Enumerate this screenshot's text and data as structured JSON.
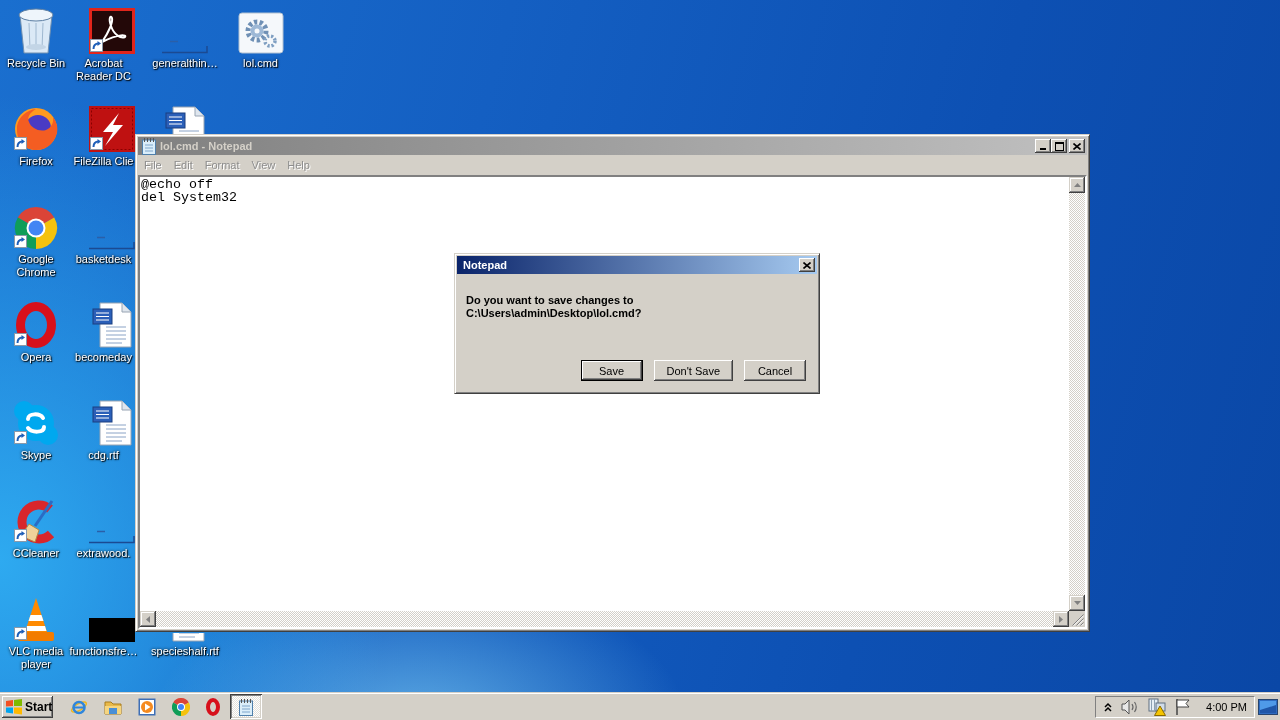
{
  "desktop": {
    "icons": [
      {
        "label": "Recycle Bin",
        "kind": "recycle-bin",
        "shortcut": false
      },
      {
        "label": "Firefox",
        "kind": "firefox",
        "shortcut": true
      },
      {
        "label": "Google Chrome",
        "kind": "chrome",
        "shortcut": true
      },
      {
        "label": "Opera",
        "kind": "opera",
        "shortcut": true
      },
      {
        "label": "Skype",
        "kind": "skype",
        "shortcut": true
      },
      {
        "label": "CCleaner",
        "kind": "ccleaner",
        "shortcut": true
      },
      {
        "label": "VLC media player",
        "kind": "vlc",
        "shortcut": true
      },
      {
        "label": "Acrobat Reader DC",
        "kind": "acrobat",
        "shortcut": true
      },
      {
        "label": "FileZilla Clie",
        "kind": "filezilla",
        "shortcut": true
      },
      {
        "label": "basketdesk",
        "kind": "line-file",
        "shortcut": false
      },
      {
        "label": "becomeday",
        "kind": "document",
        "shortcut": false
      },
      {
        "label": "cdg.rtf",
        "kind": "document",
        "shortcut": false
      },
      {
        "label": "extrawood.",
        "kind": "line-file",
        "shortcut": false
      },
      {
        "label": "functionsfre…",
        "kind": "dark-file",
        "shortcut": false
      },
      {
        "label": "generalthin…",
        "kind": "line-file",
        "shortcut": false
      },
      {
        "kind": "document",
        "shortcut": false
      },
      {
        "label": "specieshalf.rtf",
        "kind": "document",
        "shortcut": false
      },
      {
        "label": "lol.cmd",
        "kind": "script",
        "shortcut": false
      }
    ]
  },
  "notepad": {
    "title": "lol.cmd - Notepad",
    "menu": [
      {
        "label": "File",
        "disabled": true
      },
      {
        "label": "Edit",
        "disabled": true
      },
      {
        "label": "Format",
        "disabled": true
      },
      {
        "label": "View",
        "disabled": true
      },
      {
        "label": "Help",
        "disabled": true
      }
    ],
    "text": "@echo off\ndel System32"
  },
  "dialog": {
    "title": "Notepad",
    "message": "Do you want to save changes to\nC:\\Users\\admin\\Desktop\\lol.cmd?",
    "buttons": [
      {
        "label": "Save",
        "default": true
      },
      {
        "label": "Don't Save",
        "default": false
      },
      {
        "label": "Cancel",
        "default": false
      }
    ]
  },
  "taskbar": {
    "start": "Start",
    "tasks": [
      {
        "selected": true
      }
    ],
    "clock": "4:00 PM"
  }
}
